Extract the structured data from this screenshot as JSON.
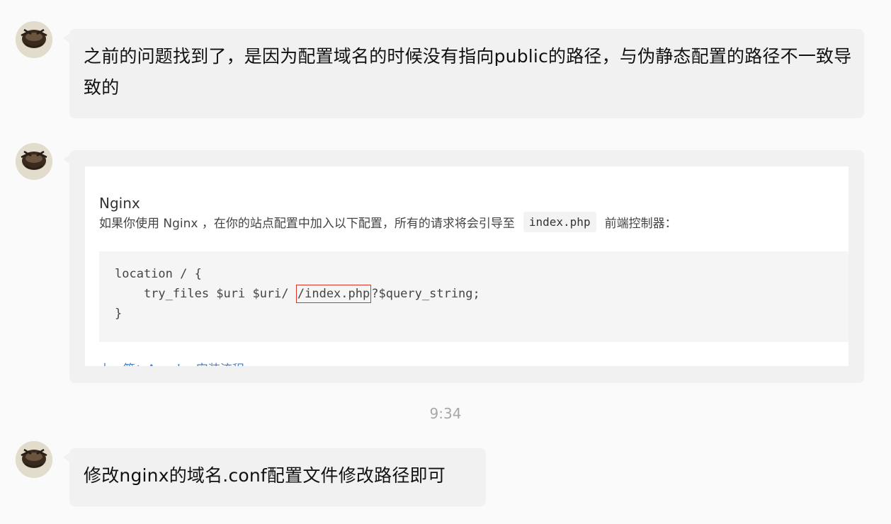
{
  "messages": [
    {
      "sender_icon": "avatar",
      "type": "text",
      "text": "之前的问题找到了，是因为配置域名的时候没有指向public的路径，与伪静态配置的路径不一致导致的"
    },
    {
      "sender_icon": "avatar",
      "type": "image",
      "screenshot": {
        "title": "Nginx",
        "desc_before": "如果你使用 Nginx ，在你的站点配置中加入以下配置，所有的请求将会引导至",
        "inline_code": "index.php",
        "desc_after": "前端控制器：",
        "code_line1": "location / {",
        "code_line2_before": "    try_files $uri $uri/ ",
        "code_line2_highlight": "/index.php",
        "code_line2_after": "?$query_string;",
        "code_line3": "}",
        "cutoff_text": "上一篇：Apache 安装流程"
      }
    },
    {
      "sender_icon": "avatar",
      "type": "text",
      "text": "修改nginx的域名.conf配置文件修改路径即可"
    }
  ],
  "timestamp": "9:34",
  "colors": {
    "background": "#fafafa",
    "bubble": "#f1f1f1",
    "highlight": "#d9342b",
    "timestamp": "#a8a8a8"
  }
}
